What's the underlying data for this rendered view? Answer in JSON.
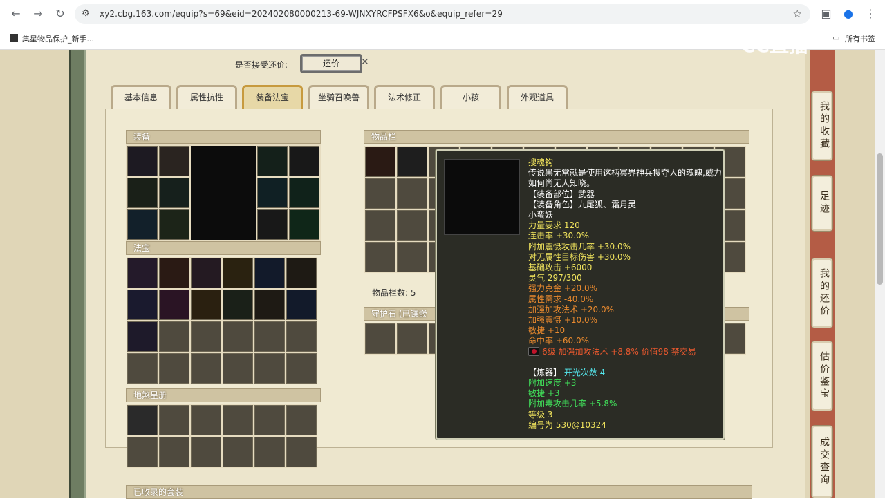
{
  "browser": {
    "url": "xy2.cbg.163.com/equip?s=69&eid=202402080000213-69-WJNXYRCFPSFX6&o&equip_refer=29",
    "bookmarks": [
      "集星物品保护_新手...",
      "所有书签"
    ]
  },
  "watermark": "CC直播",
  "offer": {
    "label": "是否接受还价:",
    "button": "还价"
  },
  "tabs": [
    "基本信息",
    "属性抗性",
    "装备法宝",
    "坐骑召唤兽",
    "法术修正",
    "小孩",
    "外观道具"
  ],
  "active_tab": "装备法宝",
  "panels": {
    "equipment": "装备",
    "fabao": "法宝",
    "disha": "地煞星册",
    "items": "物品栏",
    "items_count": "物品栏数: 5",
    "guard_stone": "守护石 (已镶嵌",
    "suits": "已收录的套装"
  },
  "side_buttons": [
    "我的收藏",
    "足迹",
    "我的还价",
    "估价鉴宝",
    "成交查询"
  ],
  "tooltip": {
    "name": "搜魂钩",
    "desc": "传说黑无常就是使用这柄冥界神兵搜夺人的魂魄,威力如何尚无人知晓。",
    "slot": "【装备部位】武器",
    "roles": "【装备角色】九尾狐、霜月灵",
    "roles2": "小蛮妖",
    "base_attrs": [
      "力量要求 120",
      "连击率 +30.0%",
      "附加震慑攻击几率 +30.0%",
      "对无属性目标伤害 +30.0%",
      "基础攻击 +6000",
      "灵气 297/300"
    ],
    "extra_attrs": [
      "强力克金 +20.0%",
      "属性需求 -40.0%",
      "加强加攻法术 +20.0%",
      "加强震慑 +10.0%",
      "敏捷 +10",
      "命中率 +60.0%"
    ],
    "gem_line": "6级 加强加攻法术 +8.8% 价值98 禁交易",
    "refine_label": "【炼器】",
    "refine_count": "开光次数 4",
    "refine_attrs": [
      "附加速度 +3",
      "敏捷 +3",
      "附加毒攻击几率 +5.8%"
    ],
    "level": "等级 3",
    "serial": "编号为 530@10324"
  },
  "colors": {
    "page_bg": "#e0d6b7",
    "tooltip_bg": "#2b2c25",
    "tooltip_yellow": "#f1e45d",
    "tooltip_orange": "#e8892e",
    "tooltip_green": "#41e05a"
  }
}
